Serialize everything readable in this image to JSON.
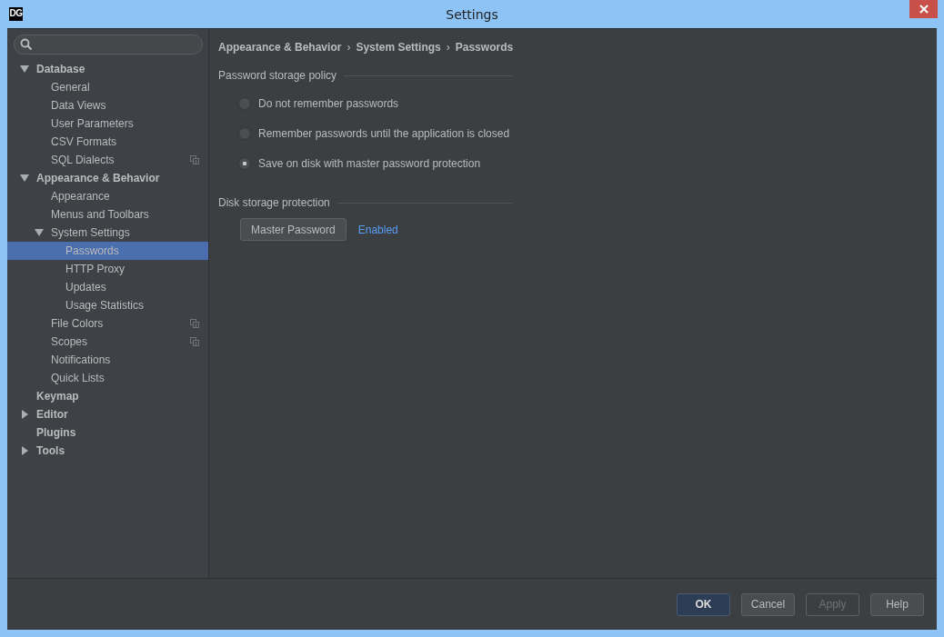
{
  "window": {
    "title": "Settings",
    "logo": "DG"
  },
  "tree": [
    {
      "label": "Database",
      "bold": true,
      "expanded": true,
      "selected": false,
      "children": [
        {
          "label": "General",
          "selected": false
        },
        {
          "label": "Data Views",
          "selected": false
        },
        {
          "label": "User Parameters",
          "selected": false
        },
        {
          "label": "CSV Formats",
          "selected": false
        },
        {
          "label": "SQL Dialects",
          "selected": false,
          "project_level": true
        }
      ]
    },
    {
      "label": "Appearance & Behavior",
      "bold": true,
      "expanded": true,
      "selected": false,
      "children": [
        {
          "label": "Appearance",
          "selected": false
        },
        {
          "label": "Menus and Toolbars",
          "selected": false
        },
        {
          "label": "System Settings",
          "expanded": true,
          "selected": false,
          "children": [
            {
              "label": "Passwords",
              "selected": true
            },
            {
              "label": "HTTP Proxy",
              "selected": false
            },
            {
              "label": "Updates",
              "selected": false
            },
            {
              "label": "Usage Statistics",
              "selected": false
            }
          ]
        },
        {
          "label": "File Colors",
          "selected": false,
          "project_level": true
        },
        {
          "label": "Scopes",
          "selected": false,
          "project_level": true
        },
        {
          "label": "Notifications",
          "selected": false
        },
        {
          "label": "Quick Lists",
          "selected": false
        }
      ]
    },
    {
      "label": "Keymap",
      "bold": true,
      "selected": false
    },
    {
      "label": "Editor",
      "bold": true,
      "expanded": false,
      "selected": false
    },
    {
      "label": "Plugins",
      "bold": true,
      "selected": false
    },
    {
      "label": "Tools",
      "bold": true,
      "expanded": false,
      "selected": false
    }
  ],
  "breadcrumb": [
    "Appearance & Behavior",
    "System Settings",
    "Passwords"
  ],
  "breadcrumb_separator": "›",
  "password_policy": {
    "title": "Password storage policy",
    "options": [
      {
        "label": "Do not remember passwords",
        "selected": false
      },
      {
        "label": "Remember passwords until the application is closed",
        "selected": false
      },
      {
        "label": "Save on disk with master password protection",
        "selected": true
      }
    ]
  },
  "disk_protection": {
    "title": "Disk storage protection",
    "button": "Master Password",
    "status": "Enabled"
  },
  "buttons": [
    {
      "label": "OK",
      "kind": "default",
      "disabled": false
    },
    {
      "label": "Cancel",
      "kind": "normal",
      "disabled": false
    },
    {
      "label": "Apply",
      "kind": "normal",
      "disabled": true
    },
    {
      "label": "Help",
      "kind": "normal",
      "disabled": false
    }
  ]
}
